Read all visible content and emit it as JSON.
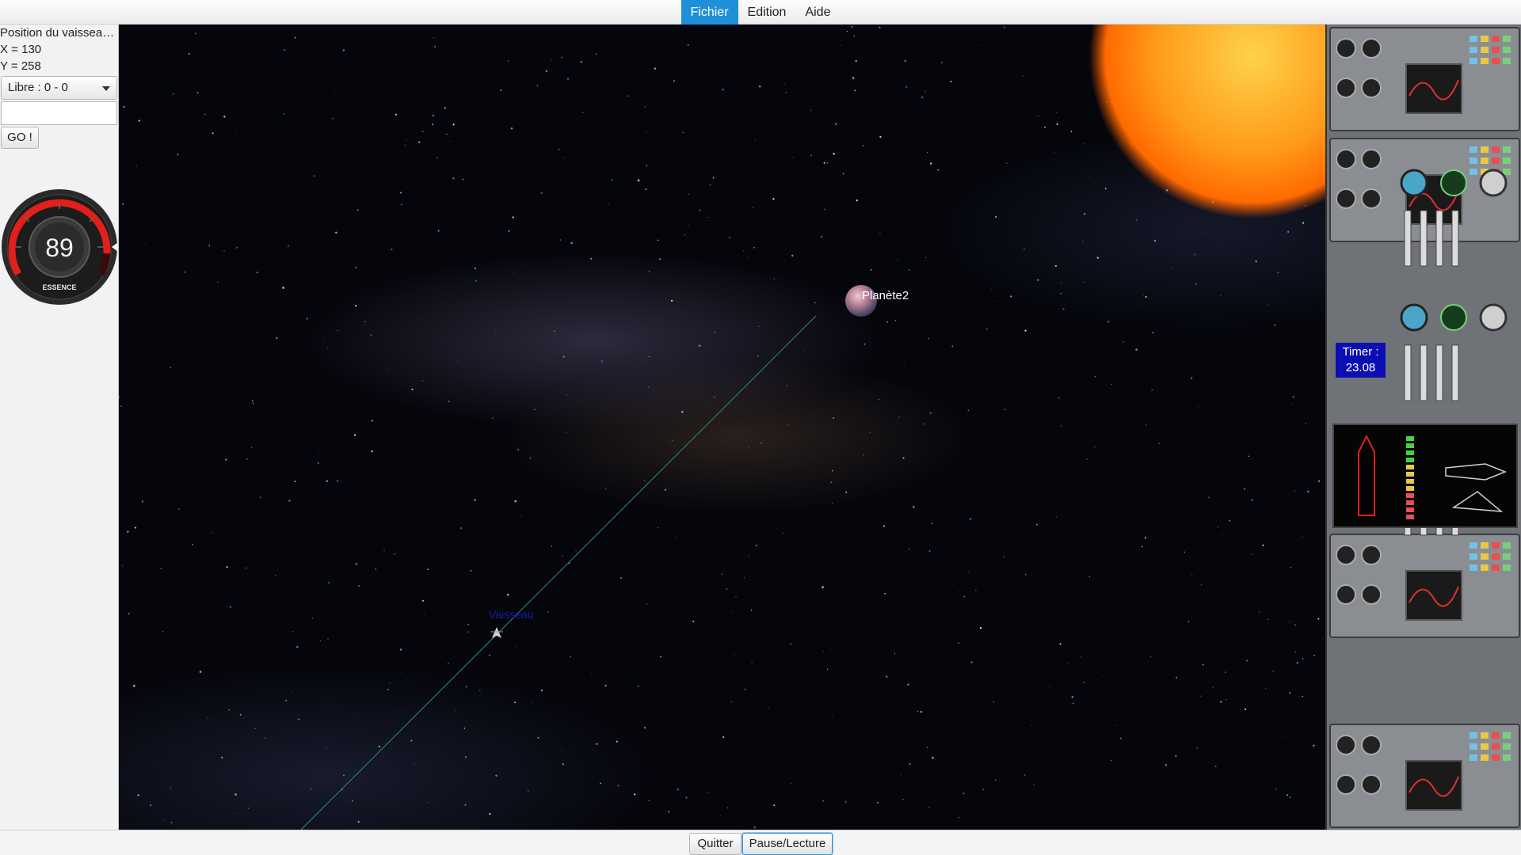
{
  "menu": {
    "items": [
      "Fichier",
      "Edition",
      "Aide"
    ]
  },
  "left": {
    "position_title": "Position du vaisseau ...",
    "x_text": "X = 130",
    "y_text": "Y = 258",
    "destination_select": "Libre : 0 - 0",
    "input_value": "",
    "go_label": "GO !"
  },
  "gauge": {
    "value": "89",
    "label": "ESSENCE",
    "level": 0.89
  },
  "space": {
    "planet_label": "Planète2",
    "ship_label": "Vaisseau"
  },
  "controls": {
    "timer_label": "Timer :",
    "timer_value": "23.08"
  },
  "bottom": {
    "quit_label": "Quitter",
    "pause_label": "Pause/Lecture"
  },
  "colors": {
    "menu_active": "#1e90d8",
    "ship_label": "#1a1aa8",
    "timer_bg": "#0b0fb3",
    "gauge_red": "#e0201c"
  }
}
